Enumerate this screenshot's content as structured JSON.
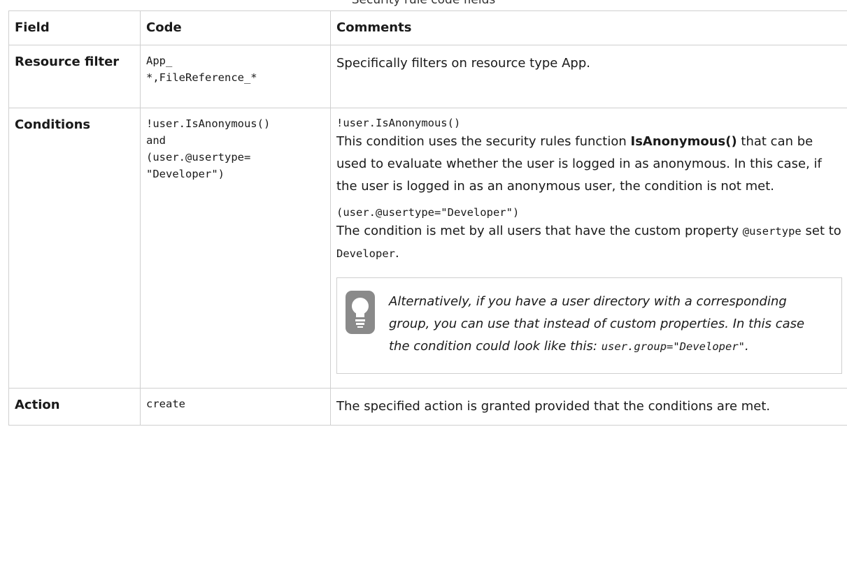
{
  "caption": "Security rule code fields",
  "headers": {
    "field": "Field",
    "code": "Code",
    "comments": "Comments"
  },
  "rows": {
    "resource_filter": {
      "field": "Resource filter",
      "code_line1": "App_",
      "code_line2": "*,FileReference_*",
      "comment": "Specifically filters on resource type App."
    },
    "conditions": {
      "field": "Conditions",
      "code_line1": "!user.IsAnonymous()",
      "code_line2": "and",
      "code_line3": "(user.@usertype=",
      "code_line4": "\"Developer\")",
      "c1_code": "!user.IsAnonymous()",
      "c1_text_before": "This condition uses the security rules function ",
      "c1_bold": "IsAnonymous()",
      "c1_text_after": " that can be used to evaluate whether the user is logged in as anonymous. In this case, if the user is logged in as an anonymous user, the condition is not met.",
      "c2_code": "(user.@usertype=\"Developer\")",
      "c2_text_before": "The condition is met by all users that have the custom property ",
      "c2_code_prop": "@usertype",
      "c2_text_mid": " set to ",
      "c2_code_val": "Developer",
      "c2_text_end": ".",
      "tip_icon": "lightbulb-icon",
      "tip_text_before": "Alternatively, if you have a user directory with a corresponding group, you can use that instead of custom properties. In this case the condition could look like this: ",
      "tip_code": "user.group=\"Developer\"",
      "tip_text_after": "."
    },
    "action": {
      "field": "Action",
      "code": "create",
      "comment": "The specified action is granted provided that the conditions are met."
    }
  },
  "colors": {
    "border": "#cfcfcf",
    "icon": "#8a8a8a"
  }
}
